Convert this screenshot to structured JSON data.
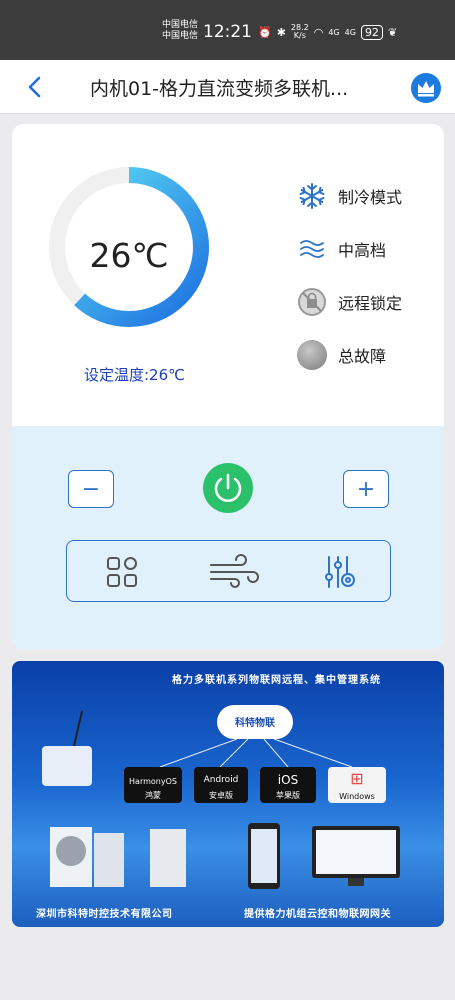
{
  "status_bar": {
    "carrier": "中国电信\n中国电信",
    "time": "12:21",
    "net_speed_value": "28.2",
    "net_speed_unit": "K/s",
    "signal_label_1": "4G",
    "signal_label_2": "4G",
    "battery": "92"
  },
  "header": {
    "title": "内机01-格力直流变频多联机...",
    "back_icon": "chevron-left-icon",
    "vip_icon": "crown-icon"
  },
  "thermostat": {
    "temperature": "26℃",
    "set_temperature": "设定温度:26℃",
    "gauge_fill_fraction": 0.62
  },
  "status_items": [
    {
      "icon": "snowflake-icon",
      "label": "制冷模式"
    },
    {
      "icon": "fan-speed-icon",
      "label": "中高档"
    },
    {
      "icon": "remote-lock-icon",
      "label": "远程锁定"
    },
    {
      "icon": "fault-indicator-icon",
      "label": "总故障"
    }
  ],
  "controls": {
    "minus": "−",
    "plus": "+",
    "power_icon": "power-icon",
    "tools": [
      "grid-menu-icon",
      "wind-icon",
      "settings-slider-icon"
    ]
  },
  "banner": {
    "title": "格力多联机系列物联网远程、集中管理系统",
    "cloud_label": "科特物联",
    "os_items": [
      {
        "big": "HarmonyOS",
        "name": "鸿蒙"
      },
      {
        "big": "Android",
        "name": "安卓版"
      },
      {
        "big": "iOS",
        "name": "苹果版"
      },
      {
        "big": "Windows",
        "name": "Windows"
      }
    ],
    "footer_left": "深圳市科特时控技术有限公司",
    "footer_right": "提供格力机组云控和物联网网关"
  },
  "colors": {
    "accent_blue": "#2f73c7",
    "power_green": "#2bc06a",
    "gauge_start": "#1d6fe0",
    "gauge_end": "#5ee0f5",
    "control_bg": "#e1f1fb"
  }
}
